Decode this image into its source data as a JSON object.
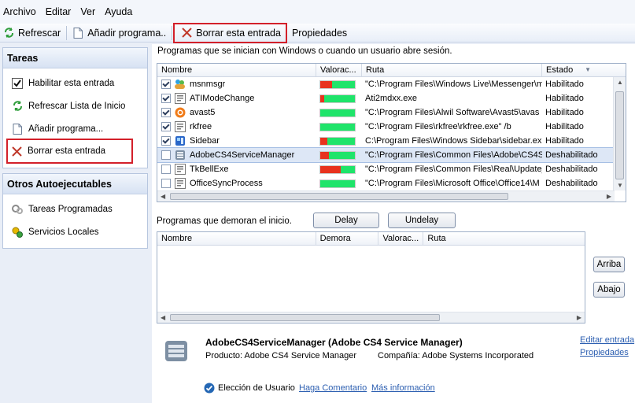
{
  "menu": [
    "Archivo",
    "Editar",
    "Ver",
    "Ayuda"
  ],
  "toolbar": {
    "refresh": "Refrescar",
    "add": "Añadir programa..",
    "delete": "Borrar esta entrada",
    "properties": "Propiedades"
  },
  "tasks": {
    "title": "Tareas",
    "items": [
      "Habilitar esta entrada",
      "Refrescar Lista de Inicio",
      "Añadir programa...",
      "Borrar esta entrada"
    ]
  },
  "others": {
    "title": "Otros Autoejecutables",
    "items": [
      "Tareas Programadas",
      "Servicios Locales"
    ]
  },
  "startup": {
    "caption": "Programas que se inician con Windows o cuando un usuario abre sesión.",
    "columns": [
      "Nombre",
      "Valorac...",
      "Ruta",
      "Estado"
    ],
    "rows": [
      {
        "name": "msnmsgr",
        "checked": true,
        "rating": 0.33,
        "path": "\"C:\\Program Files\\Windows Live\\Messenger\\m",
        "status": "Habilitado"
      },
      {
        "name": "ATIModeChange",
        "checked": true,
        "rating": 0.12,
        "path": "Ati2mdxx.exe",
        "status": "Habilitado"
      },
      {
        "name": "avast5",
        "checked": true,
        "rating": 0.0,
        "path": "\"C:\\Program Files\\Alwil Software\\Avast5\\avas",
        "status": "Habilitado"
      },
      {
        "name": "rkfree",
        "checked": true,
        "rating": 0.0,
        "path": "\"C:\\Program Files\\rkfree\\rkfree.exe\" /b",
        "status": "Habilitado"
      },
      {
        "name": "Sidebar",
        "checked": true,
        "rating": 0.2,
        "path": "C:\\Program Files\\Windows Sidebar\\sidebar.ex",
        "status": "Habilitado"
      },
      {
        "name": "AdobeCS4ServiceManager",
        "checked": false,
        "rating": 0.25,
        "path": "\"C:\\Program Files\\Common Files\\Adobe\\CS4S",
        "status": "Deshabilitado",
        "selected": true
      },
      {
        "name": "TkBellExe",
        "checked": false,
        "rating": 0.6,
        "path": "\"C:\\Program Files\\Common Files\\Real\\Update_",
        "status": "Deshabilitado"
      },
      {
        "name": "OfficeSyncProcess",
        "checked": false,
        "rating": 0.0,
        "path": "\"C:\\Program Files\\Microsoft Office\\Office14\\M",
        "status": "Deshabilitado"
      }
    ]
  },
  "delayed": {
    "caption": "Programas que demoran el inicio.",
    "delay_btn": "Delay",
    "undelay_btn": "Undelay",
    "columns": [
      "Nombre",
      "Demora",
      "Valorac...",
      "Ruta"
    ],
    "up_btn": "Arriba",
    "down_btn": "Abajo"
  },
  "details": {
    "title": "AdobeCS4ServiceManager (Adobe CS4 Service Manager)",
    "product": "Producto: Adobe CS4 Service Manager",
    "company": "Compañía: Adobe Systems Incorporated",
    "choice": "Elección de Usuario",
    "comment": "Haga Comentario",
    "more": "Más información",
    "edit": "Editar entrada",
    "props": "Propiedades"
  }
}
